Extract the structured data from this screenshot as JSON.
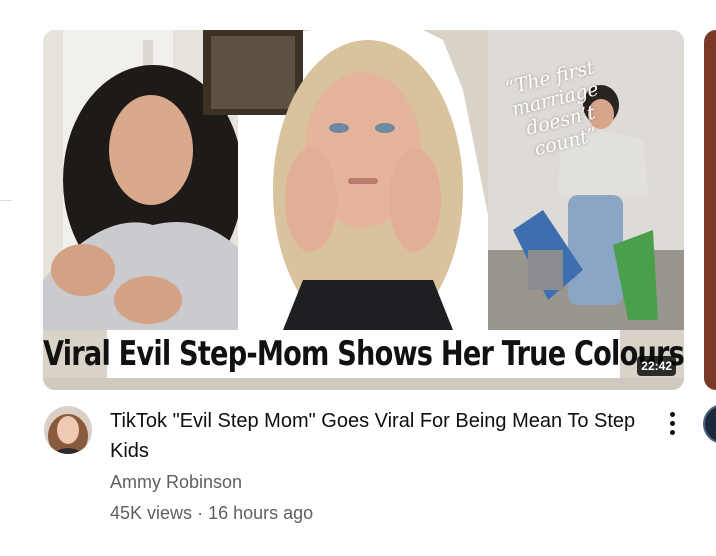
{
  "video": {
    "thumbnail_headline": "Viral Evil Step-Mom Shows Her True Colours",
    "thumbnail_quote": "“The first marriage doesn’t count”",
    "duration": "22:42",
    "title": "TikTok \"Evil Step Mom\" Goes Viral For Being Mean To Step Kids",
    "channel": "Ammy Robinson",
    "views": "45K views",
    "separator": "·",
    "age": "16 hours ago"
  },
  "icons": {
    "menu": "more-vert-icon"
  },
  "colors": {
    "title": "#0f0f0f",
    "secondary_text": "#606060",
    "duration_bg": "#000000"
  }
}
